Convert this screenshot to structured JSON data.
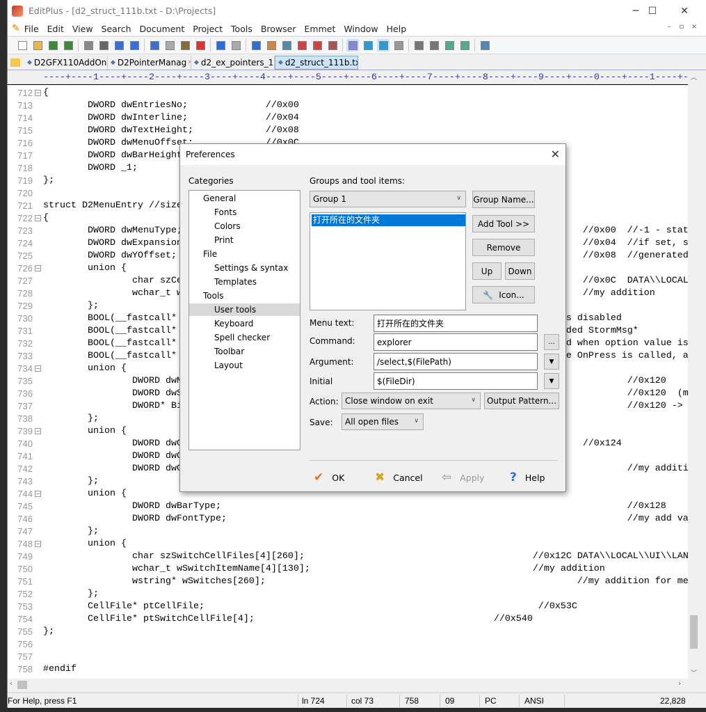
{
  "window": {
    "title": "EditPlus - [d2_struct_111b.txt - D:\\Projects]",
    "minimize": "─",
    "maximize": "☐",
    "close": "✕"
  },
  "menu": [
    "File",
    "Edit",
    "View",
    "Search",
    "Document",
    "Project",
    "Tools",
    "Browser",
    "Emmet",
    "Window",
    "Help"
  ],
  "mdi_controls": [
    "–",
    "▫",
    "×"
  ],
  "toolbar": {
    "icons": [
      "new-file",
      "open",
      "save",
      "save-all",
      "print-preview",
      "print",
      "spell-check",
      "browser-preview",
      "cut",
      "copy",
      "paste",
      "delete",
      "undo",
      "redo",
      "find",
      "replace",
      "find-in-files",
      "go-to",
      "font",
      "hex",
      "word-wrap",
      "line-number",
      "column-select",
      "settings",
      "cliptext",
      "directory",
      "output",
      "user-tool",
      "help"
    ]
  },
  "tabs": [
    {
      "label": "D2GFX110AddOn"
    },
    {
      "label": "D2PointerManag"
    },
    {
      "label": "d2_ex_pointers_1"
    },
    {
      "label": "d2_struct_111b.txt",
      "active": true
    }
  ],
  "ruler": "----+----1----+----2----+----3----+----4----+----5----+----6----+----7----+----8----+----9----+----0----+----1----+-",
  "editor": {
    "lines": [
      {
        "n": "712",
        "code": "{",
        "comment": ""
      },
      {
        "n": "713",
        "code": "        DWORD dwEntriesNo;",
        "comment": "//0x00"
      },
      {
        "n": "714",
        "code": "        DWORD dwInterline;",
        "comment": "//0x04"
      },
      {
        "n": "715",
        "code": "        DWORD dwTextHeight;",
        "comment": "//0x08"
      },
      {
        "n": "716",
        "code": "        DWORD dwMenuOffset;",
        "comment": "//0x0C"
      },
      {
        "n": "717",
        "code": "        DWORD dwBarHeight",
        "comment": ""
      },
      {
        "n": "718",
        "code": "        DWORD _1;",
        "comment": ""
      },
      {
        "n": "719",
        "code": "};",
        "comment": ""
      },
      {
        "n": "720",
        "code": "",
        "comment": ""
      },
      {
        "n": "721",
        "code": "struct D2MenuEntry //size",
        "comment": ""
      },
      {
        "n": "722",
        "code": "{",
        "comment": ""
      },
      {
        "n": "723",
        "code": "        DWORD dwMenuType;",
        "comment": "//0x00  //-1 - stat"
      },
      {
        "n": "724",
        "code": "        DWORD dwExpansion",
        "comment": "//0x04  //if set, s"
      },
      {
        "n": "725",
        "code": "        DWORD dwYOffset;",
        "comment": "//0x08  //generated"
      },
      {
        "n": "726",
        "code": "        union {",
        "comment": ""
      },
      {
        "n": "727",
        "code": "                char szCe",
        "comment": "//0x0C  DATA\\\\LOCAL"
      },
      {
        "n": "728",
        "code": "                wchar_t w",
        "comment": "//my addition"
      },
      {
        "n": "729",
        "code": "        };",
        "comment": ""
      },
      {
        "n": "730",
        "code": "        BOOL(__fastcall*",
        "comment": "s disabled"
      },
      {
        "n": "731",
        "code": "        BOOL(__fastcall*",
        "comment": "ded StormMsg*"
      },
      {
        "n": "732",
        "code": "        BOOL(__fastcall*",
        "comment": "d when option value is"
      },
      {
        "n": "733",
        "code": "        BOOL(__fastcall*",
        "comment": "e OnPress is called, a"
      },
      {
        "n": "734",
        "code": "        union {",
        "comment": ""
      },
      {
        "n": "735",
        "code": "                DWORD dwM",
        "comment": "//0x120"
      },
      {
        "n": "736",
        "code": "                DWORD dwS",
        "comment": "//0x120  (m"
      },
      {
        "n": "737",
        "code": "                DWORD* Bi",
        "comment": "//0x120 ->"
      },
      {
        "n": "738",
        "code": "        };",
        "comment": ""
      },
      {
        "n": "739",
        "code": "        union {",
        "comment": ""
      },
      {
        "n": "740",
        "code": "                DWORD dwC",
        "comment": "//0x124"
      },
      {
        "n": "741",
        "code": "                DWORD dwC",
        "comment": ""
      },
      {
        "n": "742",
        "code": "                DWORD dwC",
        "comment": "//my additi"
      },
      {
        "n": "743",
        "code": "        };",
        "comment": ""
      },
      {
        "n": "744",
        "code": "        union {",
        "comment": ""
      },
      {
        "n": "745",
        "code": "                DWORD dwBarType;",
        "comment": "//0x128"
      },
      {
        "n": "746",
        "code": "                DWORD dwFontType;",
        "comment": "//my add va"
      },
      {
        "n": "747",
        "code": "        };",
        "comment": ""
      },
      {
        "n": "748",
        "code": "        union {",
        "comment": ""
      },
      {
        "n": "749",
        "code": "                char szSwitchCellFiles[4][260];",
        "comment": "//0x12C DATA\\\\LOCAL\\\\UI\\\\LAN"
      },
      {
        "n": "750",
        "code": "                wchar_t wSwitchItemName[4][130];",
        "comment": "//my addition"
      },
      {
        "n": "751",
        "code": "                wstring* wSwitches[260];",
        "comment": "//my addition for me"
      },
      {
        "n": "752",
        "code": "        };",
        "comment": ""
      },
      {
        "n": "753",
        "code": "        CellFile* ptCellFile;",
        "comment": "//0x53C"
      },
      {
        "n": "754",
        "code": "        CellFile* ptSwitchCellFile[4];",
        "comment": "//0x540"
      },
      {
        "n": "755",
        "code": "};",
        "comment": ""
      },
      {
        "n": "756",
        "code": "",
        "comment": ""
      },
      {
        "n": "757",
        "code": "",
        "comment": ""
      },
      {
        "n": "758",
        "code": "#endif",
        "comment": ""
      }
    ]
  },
  "status": {
    "help": "For Help, press F1",
    "line": "ln 724",
    "col": "col 73",
    "total": "758",
    "tab": "09",
    "eol": "PC",
    "encoding": "ANSI",
    "size": "22,828"
  },
  "dialog": {
    "title": "Preferences",
    "categories_label": "Categories",
    "categories": [
      {
        "label": "General",
        "level": 1
      },
      {
        "label": "Fonts",
        "level": 2
      },
      {
        "label": "Colors",
        "level": 2
      },
      {
        "label": "Print",
        "level": 2
      },
      {
        "label": "File",
        "level": 1
      },
      {
        "label": "Settings & syntax",
        "level": 2
      },
      {
        "label": "Templates",
        "level": 2
      },
      {
        "label": "Tools",
        "level": 1
      },
      {
        "label": "User tools",
        "level": 2,
        "selected": true
      },
      {
        "label": "Keyboard",
        "level": 2
      },
      {
        "label": "Spell checker",
        "level": 2
      },
      {
        "label": "Toolbar",
        "level": 2
      },
      {
        "label": "Layout",
        "level": 2
      }
    ],
    "groups_label": "Groups and tool items:",
    "group_selected": "Group 1",
    "tool_items": [
      "打开所在的文件夹"
    ],
    "buttons": {
      "group_name": "Group Name...",
      "add_tool": "Add Tool >>",
      "remove": "Remove",
      "up": "Up",
      "down": "Down",
      "icon": "Icon...",
      "browse": "...",
      "output_pattern": "Output Pattern..."
    },
    "fields": {
      "menu_text_label": "Menu text:",
      "menu_text": "打开所在的文件夹",
      "command_label": "Command:",
      "command": "explorer",
      "argument_label": "Argument:",
      "argument": "/select,$(FilePath)",
      "initial_label": "Initial",
      "initial": "$(FileDir)",
      "action_label": "Action:",
      "action": "Close window on exit",
      "save_label": "Save:",
      "save": "All open files"
    },
    "footer": {
      "ok": "OK",
      "cancel": "Cancel",
      "apply": "Apply",
      "help": "Help"
    },
    "colors": {
      "selection": "#0078d7",
      "ok_check": "#e8731a",
      "cancel_x": "#d9a21b",
      "help_icon": "#2f6fd0"
    }
  }
}
